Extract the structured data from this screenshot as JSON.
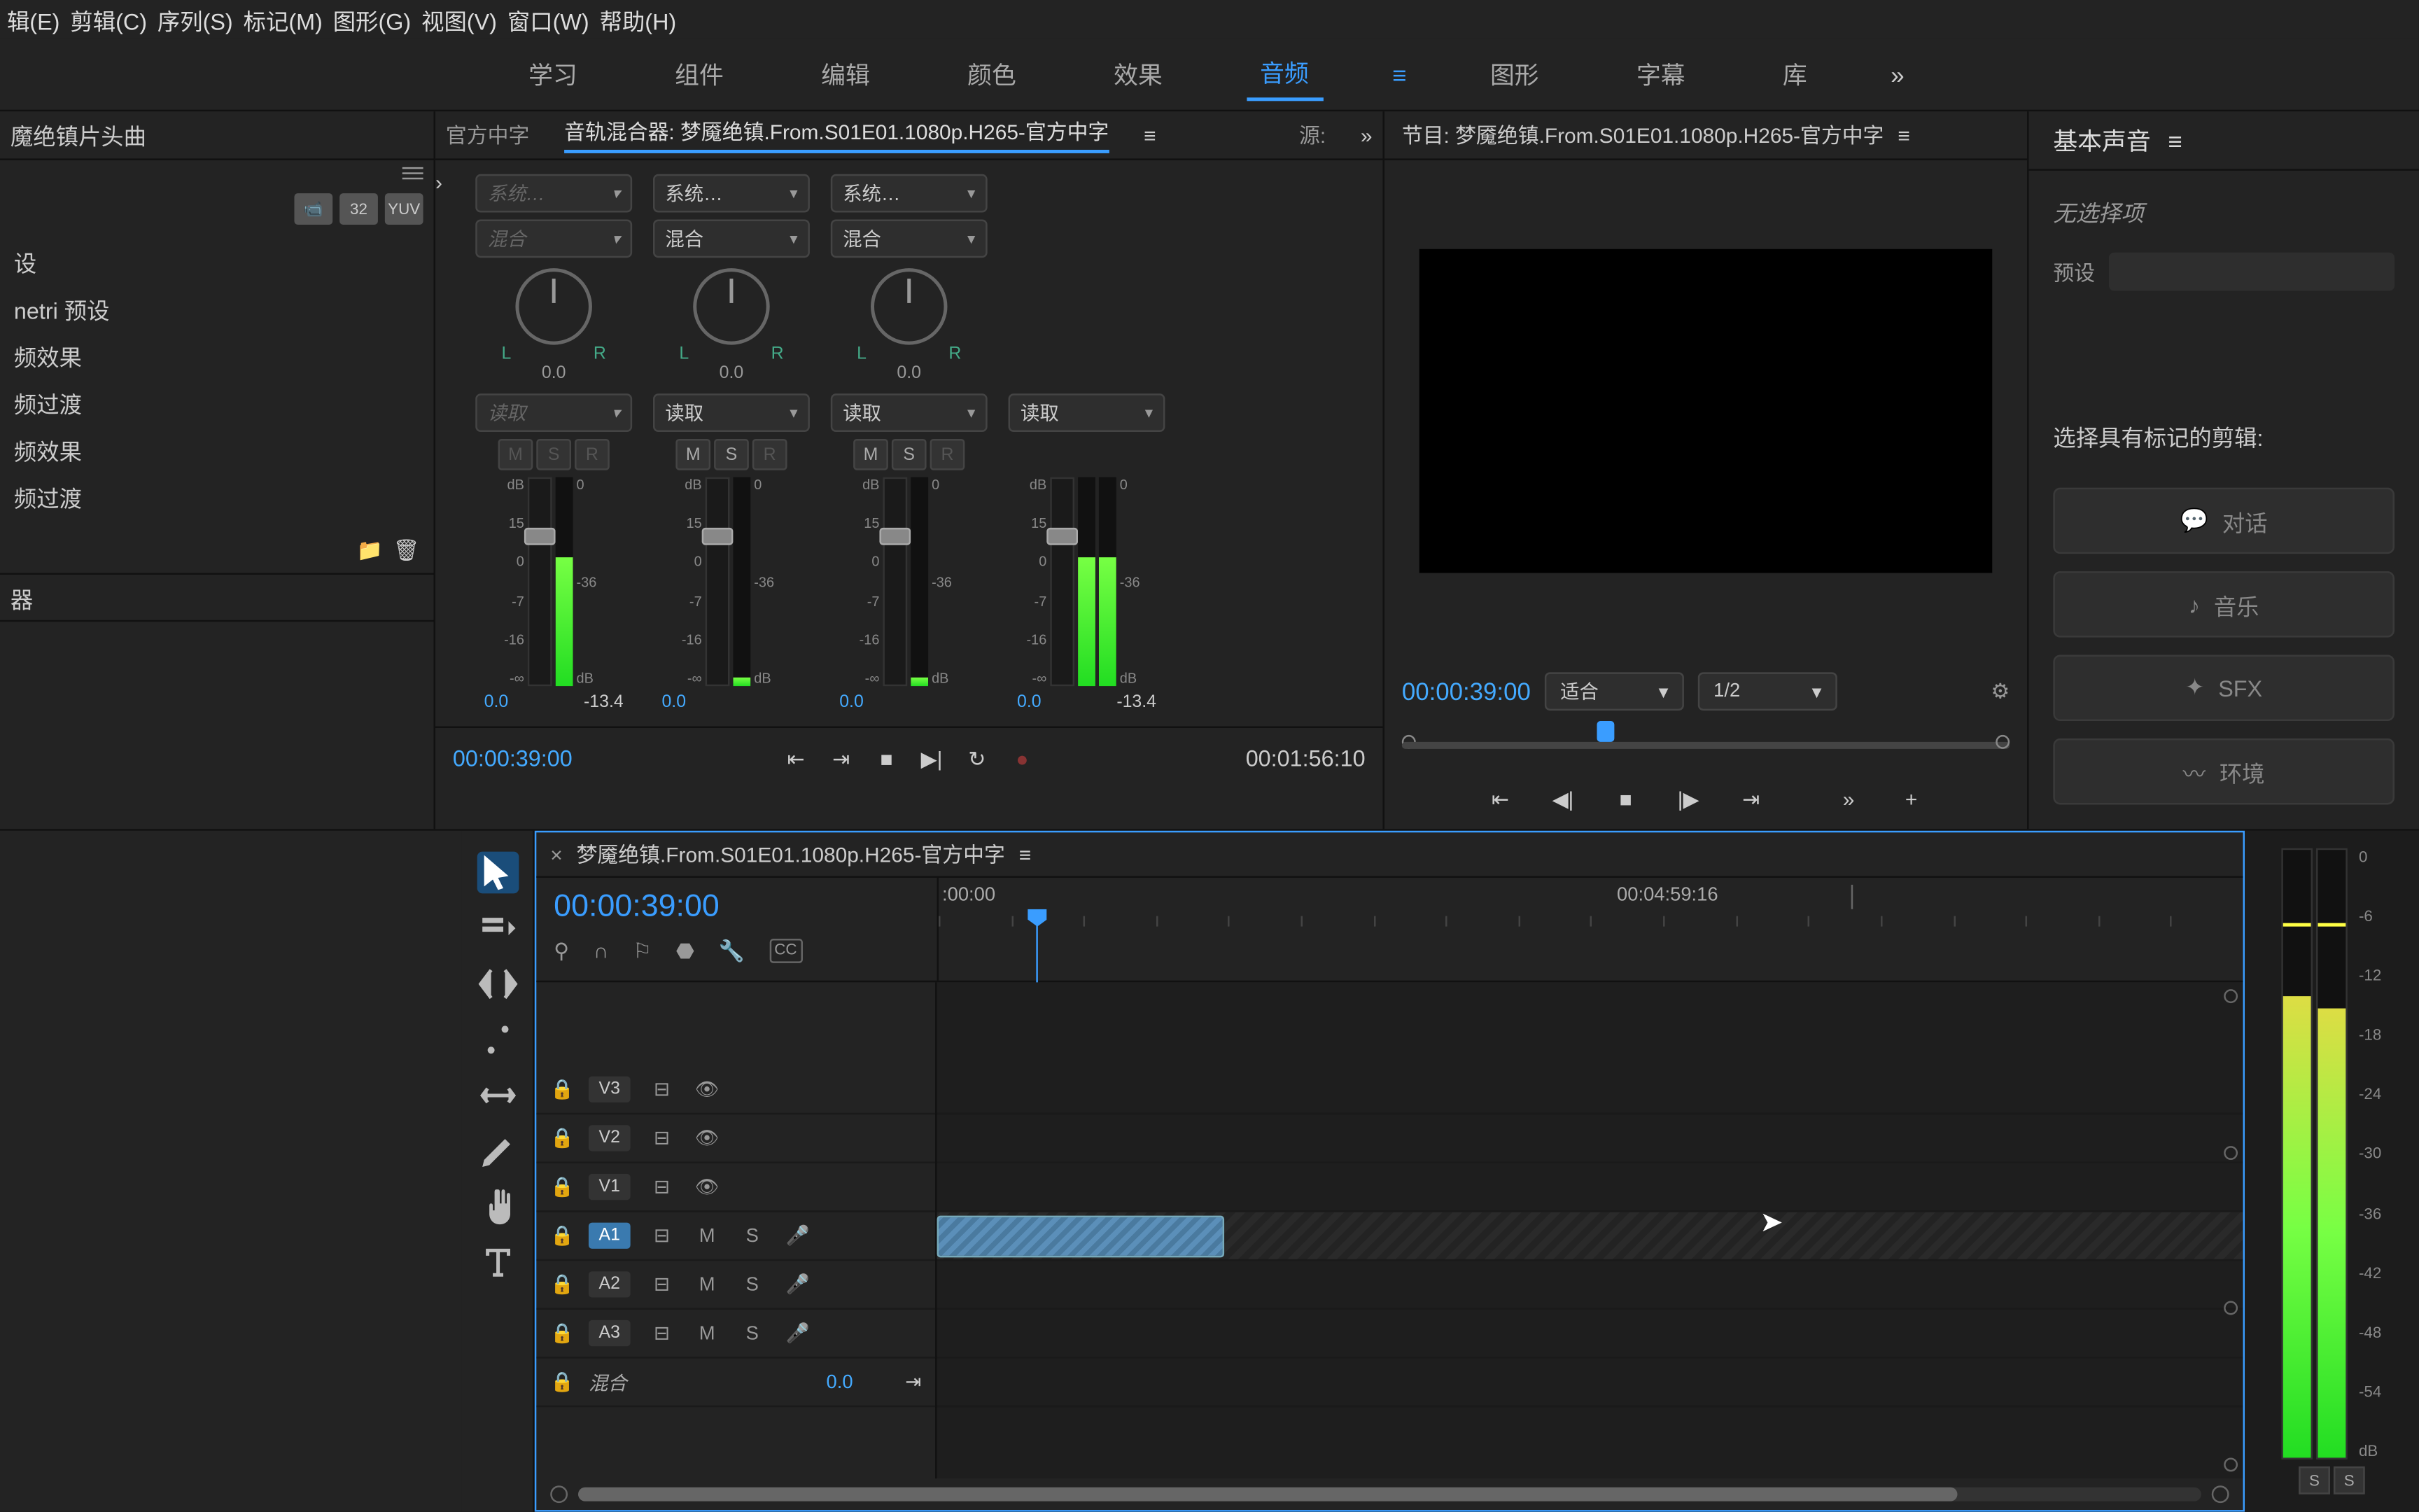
{
  "menu": [
    "辑(E)",
    "剪辑(C)",
    "序列(S)",
    "标记(M)",
    "图形(G)",
    "视图(V)",
    "窗口(W)",
    "帮助(H)"
  ],
  "workspaces": {
    "items": [
      "学习",
      "组件",
      "编辑",
      "颜色",
      "效果",
      "音频",
      "图形",
      "字幕",
      "库"
    ],
    "active": "音频"
  },
  "left": {
    "title": "魔绝镇片头曲",
    "icons": [
      "📹",
      "32",
      "YUV"
    ],
    "tree": [
      "设",
      "netri 预设",
      "频效果",
      "频过渡",
      "频效果",
      "频过渡"
    ],
    "section2": "器"
  },
  "mixer": {
    "tab_left": "官方中字",
    "tab_main": "音轨混合器: 梦魇绝镇.From.S01E01.1080p.H265-官方中字",
    "tab_source": "源:",
    "channels": [
      {
        "sys": "系统…",
        "mix": "混合",
        "sys_disabled": true,
        "knob": "0.0",
        "read": "读取",
        "read_disabled": true,
        "fader": "0.0",
        "peak": "-13.4",
        "meter_h": 62
      },
      {
        "sys": "系统…",
        "mix": "混合",
        "knob": "0.0",
        "read": "读取",
        "fader": "0.0",
        "peak": "",
        "meter_h": 4
      },
      {
        "sys": "系统…",
        "mix": "混合",
        "knob": "0.0",
        "read": "读取",
        "fader": "0.0",
        "peak": "",
        "meter_h": 4
      },
      {
        "sys": "",
        "mix": "",
        "knob": "",
        "read": "读取",
        "fader": "0.0",
        "peak": "-13.4",
        "meter_h": 62,
        "master": true
      }
    ],
    "lr": {
      "l": "L",
      "r": "R"
    },
    "msr": {
      "m": "M",
      "s": "S",
      "r": "R"
    },
    "fader_scale": [
      "dB",
      "15",
      "0",
      "-7",
      "-16",
      "-∞"
    ],
    "meter_scale": [
      "0",
      "-36",
      "dB"
    ],
    "tc": "00:00:39:00",
    "dur": "00:01:56:10"
  },
  "program": {
    "title": "节目: 梦魇绝镇.From.S01E01.1080p.H265-官方中字",
    "tc": "00:00:39:00",
    "fit": "适合",
    "res": "1/2"
  },
  "sound": {
    "title": "基本声音",
    "noselect": "无选择项",
    "preset_label": "预设",
    "label": "选择具有标记的剪辑:",
    "buttons": [
      "对话",
      "音乐",
      "SFX",
      "环境"
    ]
  },
  "timeline": {
    "title": "梦魇绝镇.From.S01E01.1080p.H265-官方中字",
    "tc": "00:00:39:00",
    "ruler": {
      "t0": ":00:00",
      "t1": "00:04:59:16"
    },
    "tracks": {
      "v3": "V3",
      "v2": "V2",
      "v1": "V1",
      "a1": "A1",
      "a2": "A2",
      "a3": "A3",
      "mix": "混合",
      "mix_val": "0.0",
      "m": "M",
      "s": "S"
    }
  },
  "meters": {
    "scale": [
      "0",
      "-6",
      "-12",
      "-18",
      "-24",
      "-30",
      "-36",
      "-42",
      "-48",
      "-54",
      "dB"
    ],
    "solo": "S"
  },
  "icons": {
    "chevron_r": "›",
    "chevron_rr": "»",
    "close": "×",
    "menu": "≡",
    "plus": "+"
  }
}
